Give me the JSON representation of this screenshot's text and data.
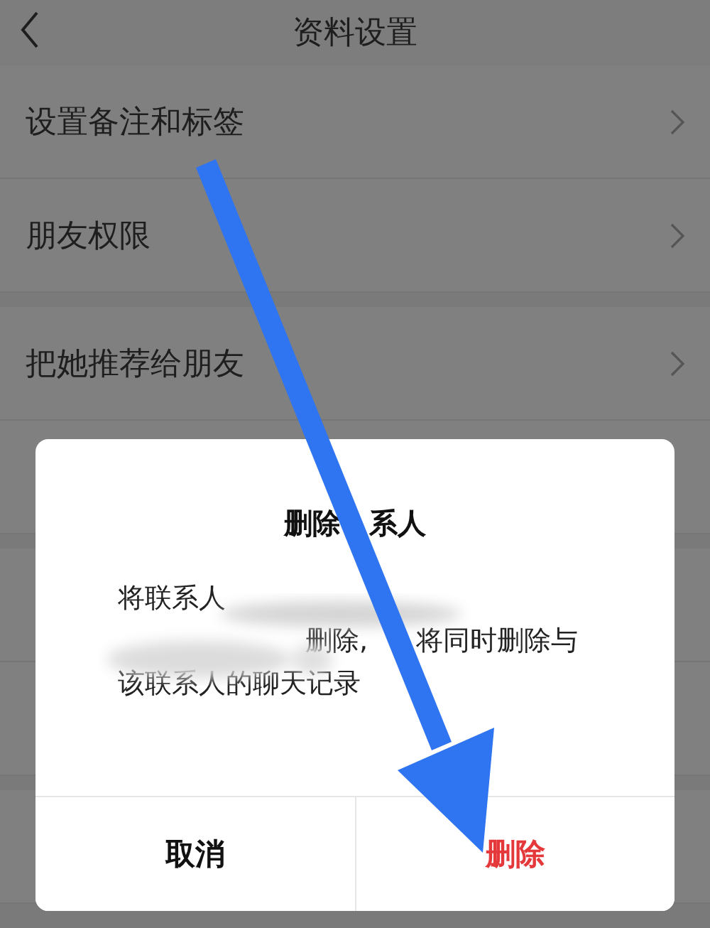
{
  "header": {
    "title": "资料设置"
  },
  "rows": [
    {
      "label": "设置备注和标签",
      "group_start": false
    },
    {
      "label": "朋友权限",
      "group_start": false
    },
    {
      "label": "把她推荐给朋友",
      "group_start": true
    }
  ],
  "dialog": {
    "title_parts": [
      "删除",
      "系人"
    ],
    "message_lines": [
      [
        "将联系人"
      ],
      [
        "删除,",
        "将同时删除与"
      ],
      [
        "该联系人的聊天记录"
      ]
    ],
    "buttons": [
      {
        "label": "取消",
        "kind": "cancel"
      },
      {
        "label": "删除",
        "kind": "danger"
      }
    ]
  }
}
